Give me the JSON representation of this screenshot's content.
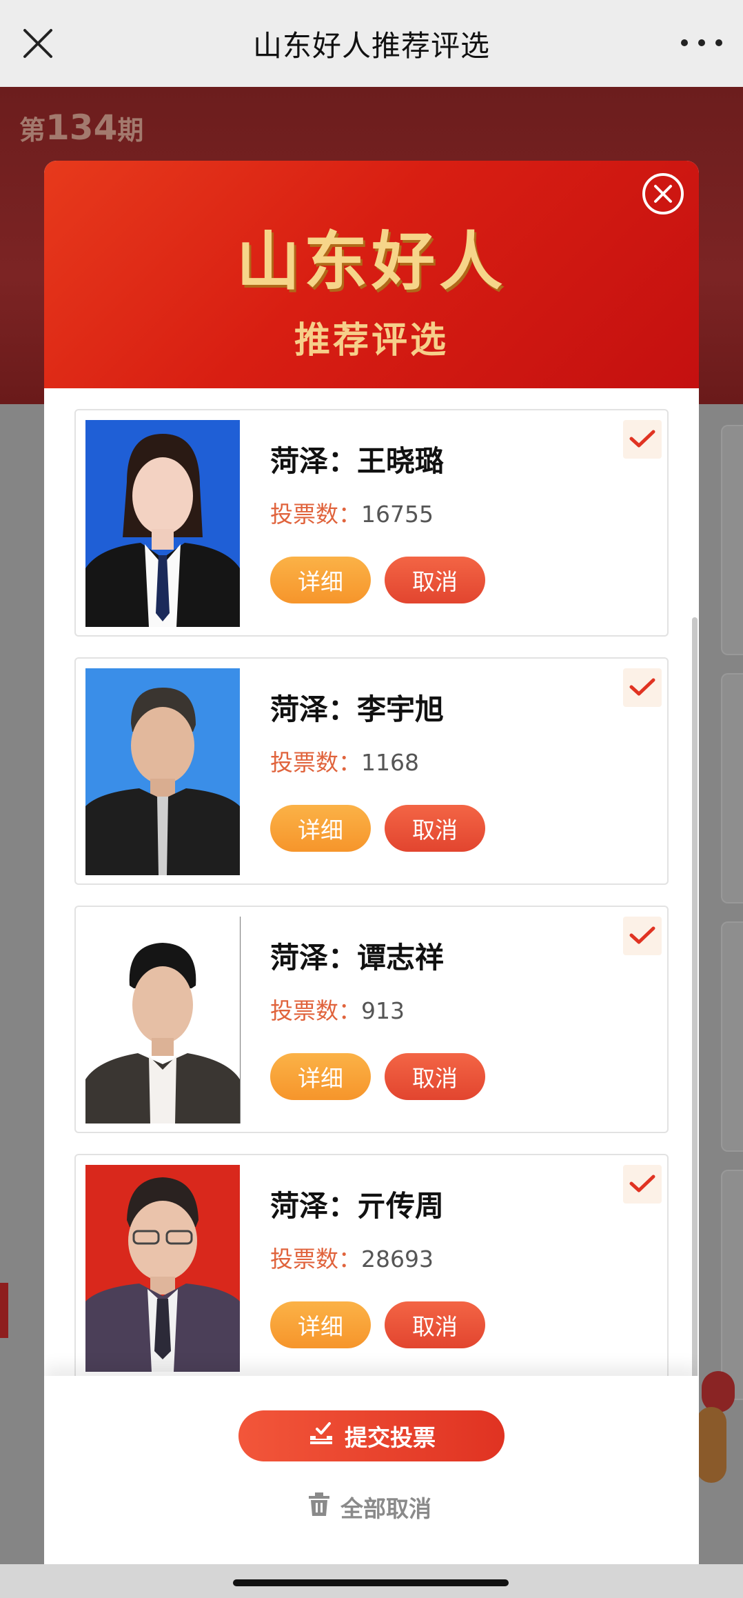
{
  "navbar": {
    "title": "山东好人推荐评选",
    "close_icon": "close-icon",
    "more_icon": "more-dots-icon"
  },
  "background": {
    "issue_prefix": "第",
    "issue_number": "134",
    "issue_suffix": "期"
  },
  "modal": {
    "header_title": "山东好人",
    "header_subtitle": "推荐评选",
    "close_icon": "close-circle-icon",
    "candidates": [
      {
        "name": "菏泽：王晓璐",
        "votes_label": "投票数：",
        "votes": "16755",
        "detail_label": "详细",
        "cancel_label": "取消",
        "selected": true,
        "photo_bg": "#1f5fd6"
      },
      {
        "name": "菏泽：李宇旭",
        "votes_label": "投票数：",
        "votes": "1168",
        "detail_label": "详细",
        "cancel_label": "取消",
        "selected": true,
        "photo_bg": "#3a8ee8"
      },
      {
        "name": "菏泽：谭志祥",
        "votes_label": "投票数：",
        "votes": "913",
        "detail_label": "详细",
        "cancel_label": "取消",
        "selected": true,
        "photo_bg": "#ffffff"
      },
      {
        "name": "菏泽：亓传周",
        "votes_label": "投票数：",
        "votes": "28693",
        "detail_label": "详细",
        "cancel_label": "取消",
        "selected": true,
        "photo_bg": "#d9281c"
      }
    ],
    "submit_label": "提交投票",
    "submit_icon": "vote-icon",
    "clear_label": "全部取消",
    "clear_icon": "trash-icon"
  },
  "colors": {
    "accent_red": "#e03322",
    "accent_orange": "#f6952b",
    "votes_label": "#e0633c",
    "header_gold": "#f6d58a"
  }
}
